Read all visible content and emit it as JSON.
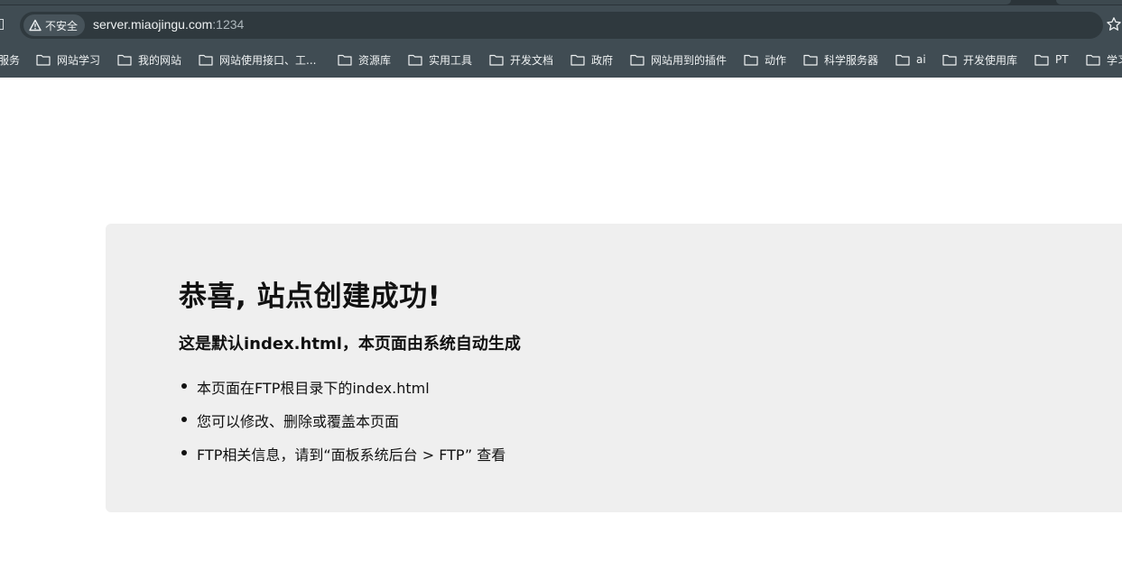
{
  "browser": {
    "security_label": "不安全",
    "url_host": "server.miaojingu.com",
    "url_port": ":1234",
    "bookmarks": [
      {
        "label": "服务",
        "has_icon": false
      },
      {
        "label": "网站学习",
        "has_icon": true
      },
      {
        "label": "我的网站",
        "has_icon": true
      },
      {
        "label": "网站使用接口、工...",
        "has_icon": true
      },
      {
        "label": "资源库",
        "has_icon": true
      },
      {
        "label": "实用工具",
        "has_icon": true
      },
      {
        "label": "开发文档",
        "has_icon": true
      },
      {
        "label": "政府",
        "has_icon": true
      },
      {
        "label": "网站用到的插件",
        "has_icon": true
      },
      {
        "label": "动作",
        "has_icon": true
      },
      {
        "label": "科学服务器",
        "has_icon": true
      },
      {
        "label": "ai",
        "has_icon": true
      },
      {
        "label": "开发使用库",
        "has_icon": true
      },
      {
        "label": "PT",
        "has_icon": true
      },
      {
        "label": "学习",
        "has_icon": true
      }
    ]
  },
  "page": {
    "title": "恭喜, 站点创建成功!",
    "subtitle": "这是默认index.html，本页面由系统自动生成",
    "items": [
      "本页面在FTP根目录下的index.html",
      "您可以修改、删除或覆盖本页面",
      "FTP相关信息，请到“面板系统后台 > FTP” 查看"
    ]
  },
  "colors": {
    "chrome": "#404c53",
    "omnibox": "#2f393e",
    "card": "#efefef"
  }
}
